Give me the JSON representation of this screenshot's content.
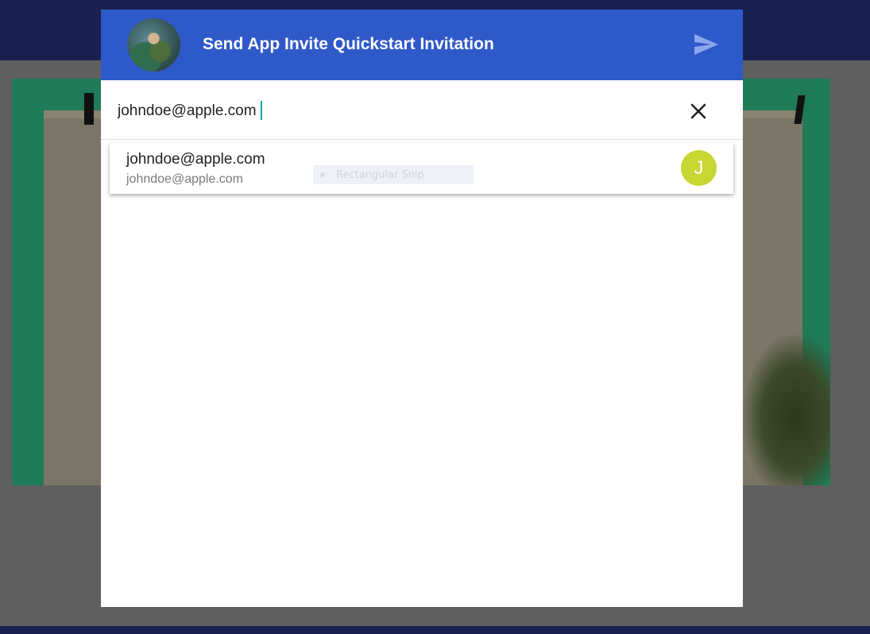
{
  "dialog": {
    "title": "Send App Invite Quickstart Invitation",
    "header_color": "#2e59c9",
    "send_icon": "send-arrow-icon",
    "avatar_icon": "user-profile-avatar"
  },
  "recipient": {
    "value": "johndoe@apple.com",
    "clear_icon": "close-icon"
  },
  "suggestions": [
    {
      "name": "johndoe@apple.com",
      "email": "johndoe@apple.com",
      "initial": "J",
      "avatar_color": "#c7d631"
    }
  ],
  "overlay": {
    "label": "Rectangular Snip"
  }
}
